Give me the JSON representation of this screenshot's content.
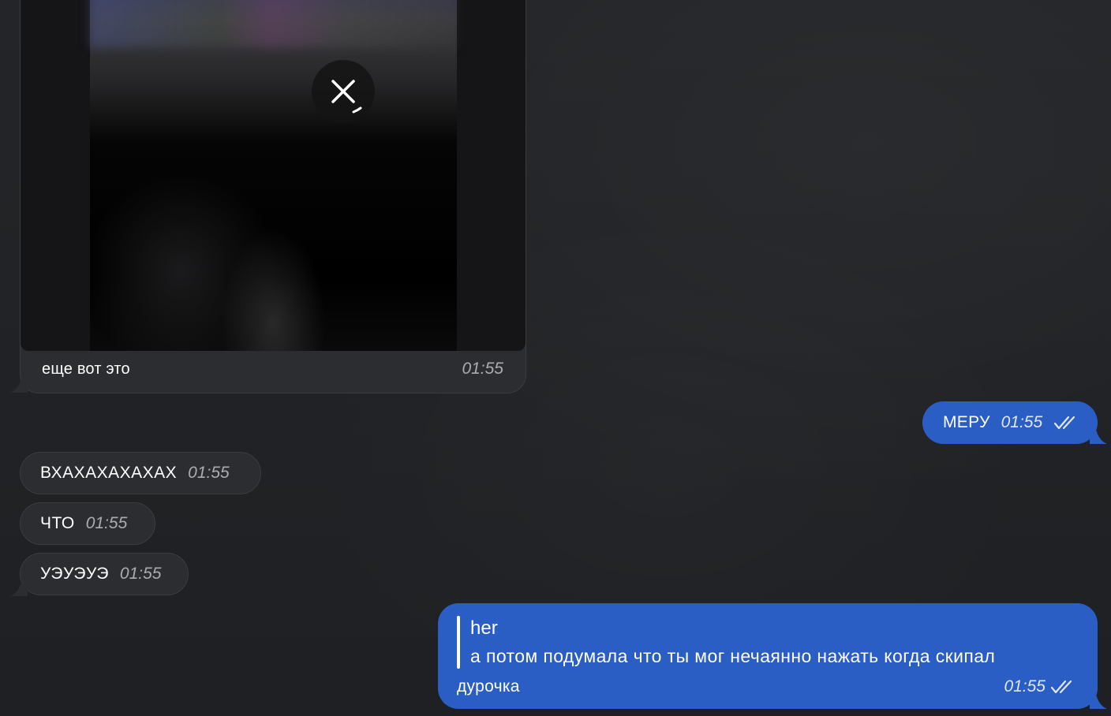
{
  "messages": {
    "media": {
      "caption": "еще вот это",
      "time": "01:55"
    },
    "out_1": {
      "text": "МЕРУ",
      "time": "01:55"
    },
    "in_1": {
      "text": "ВХАХАХАХАХАХ",
      "time": "01:55"
    },
    "in_2": {
      "text": "ЧТО",
      "time": "01:55"
    },
    "in_3": {
      "text": "УЭУЭУЭ",
      "time": "01:55"
    },
    "out_2": {
      "quote_author": "her",
      "quote_text": "а потом подумала что ты мог нечаянно нажать когда скипал",
      "text": "дурочка",
      "time": "01:55"
    }
  },
  "colors": {
    "background": "#222427",
    "incoming_bubble": "#2b2d31",
    "outgoing_bubble": "#2a5ec5"
  },
  "icons": {
    "cancel": "close-icon",
    "read_status": "double-check-icon"
  }
}
